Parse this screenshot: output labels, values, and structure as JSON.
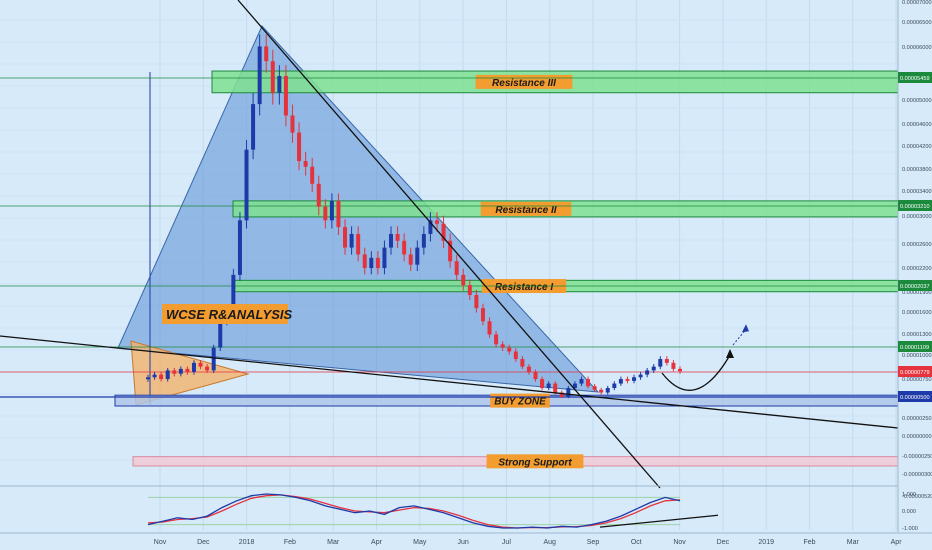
{
  "chart_data": {
    "type": "candlestick",
    "title": "WCSE R&ANALYSIS",
    "x_axis_labels": [
      "Nov",
      "Dec",
      "2018",
      "Feb",
      "Mar",
      "Apr",
      "May",
      "Jun",
      "Jul",
      "Aug",
      "Sep",
      "Oct",
      "Nov",
      "Dec",
      "2019",
      "Feb",
      "Mar",
      "Apr"
    ],
    "price_scale_labels": [
      "0.00007000",
      "0.00006500",
      "0.00006000",
      "0.00005000",
      "0.00004600",
      "0.00004200",
      "0.00003800",
      "0.00003400",
      "0.00003000",
      "0.00002600",
      "0.00002200",
      "0.00001900",
      "0.00001600",
      "0.00001300",
      "0.00001000",
      "0.00000750",
      "0.00000250",
      "0.00000000",
      "-0.00000250",
      "-0.00000300",
      "-0.00000520"
    ],
    "price_badges": [
      {
        "label": "0.00005459",
        "level": 5.459,
        "color": "#1b8a3c"
      },
      {
        "label": "0.00003210",
        "level": 3.21,
        "color": "#1b8a3c"
      },
      {
        "label": "0.00002037",
        "level": 2.037,
        "color": "#1b8a3c"
      },
      {
        "label": "0.00001109",
        "level": 1.109,
        "color": "#1b8a3c"
      },
      {
        "label": "0.00000779",
        "level": 0.779,
        "color": "#e5323d"
      },
      {
        "label": "0.00000500",
        "level": 0.5,
        "color": "#1e3aa8"
      }
    ],
    "zones": [
      {
        "label": "Resistance III",
        "low": 5.2,
        "high": 5.6
      },
      {
        "label": "Resistance II",
        "low": 3.05,
        "high": 3.3
      },
      {
        "label": "Resistance I",
        "low": 1.95,
        "high": 2.12
      },
      {
        "label": "BUY ZONE",
        "low": 0.35,
        "high": 0.52
      },
      {
        "label": "Strong Support",
        "low": -0.42,
        "high": -0.32
      }
    ],
    "close_series": [
      0.72,
      0.75,
      0.7,
      0.8,
      0.76,
      0.82,
      0.78,
      0.9,
      0.85,
      0.8,
      1.1,
      1.5,
      1.6,
      2.2,
      3.0,
      4.2,
      5.0,
      6.1,
      5.8,
      5.2,
      5.5,
      4.8,
      4.5,
      4.0,
      3.9,
      3.6,
      3.2,
      3.0,
      3.3,
      2.9,
      2.6,
      2.8,
      2.5,
      2.3,
      2.45,
      2.3,
      2.6,
      2.8,
      2.7,
      2.5,
      2.35,
      2.6,
      2.8,
      3.0,
      2.95,
      2.7,
      2.4,
      2.2,
      2.05,
      1.9,
      1.7,
      1.5,
      1.3,
      1.15,
      1.1,
      1.05,
      0.95,
      0.85,
      0.78,
      0.7,
      0.6,
      0.65,
      0.55,
      0.5,
      0.6,
      0.65,
      0.7,
      0.62,
      0.58,
      0.55,
      0.6,
      0.65,
      0.7,
      0.68,
      0.72,
      0.75,
      0.8,
      0.85,
      0.95,
      0.9,
      0.82,
      0.79
    ],
    "projection": {
      "bottom": 0.45,
      "target": 1.5
    },
    "oscillator": {
      "scale_labels": [
        "1.000",
        "0.000",
        "-1.000"
      ],
      "k_series": [
        -0.8,
        -0.6,
        -0.4,
        -0.5,
        -0.3,
        0.2,
        0.6,
        0.9,
        1.0,
        0.95,
        0.8,
        0.6,
        0.3,
        0.1,
        -0.1,
        0.0,
        -0.2,
        0.2,
        0.3,
        0.1,
        -0.1,
        -0.4,
        -0.7,
        -0.9,
        -1.0,
        -1.0,
        -0.95,
        -1.0,
        -0.9,
        -0.95,
        -0.8,
        -0.6,
        -0.3,
        0.1,
        0.5,
        0.8,
        0.6
      ],
      "d_series": [
        -0.7,
        -0.65,
        -0.5,
        -0.45,
        -0.35,
        0.0,
        0.4,
        0.75,
        0.9,
        0.95,
        0.85,
        0.7,
        0.45,
        0.2,
        0.0,
        -0.05,
        -0.1,
        0.05,
        0.2,
        0.15,
        0.0,
        -0.25,
        -0.55,
        -0.8,
        -0.95,
        -1.0,
        -0.97,
        -0.98,
        -0.93,
        -0.92,
        -0.85,
        -0.7,
        -0.45,
        -0.1,
        0.3,
        0.6,
        0.65
      ],
      "k_color": "#1e3aa8",
      "d_color": "#e5323d"
    },
    "colors": {
      "up": "#1e3aa8",
      "down": "#e5323d",
      "zone": "#7fe08f",
      "wedge": "#5b8fd4",
      "triangle": "#f2b36b"
    }
  }
}
